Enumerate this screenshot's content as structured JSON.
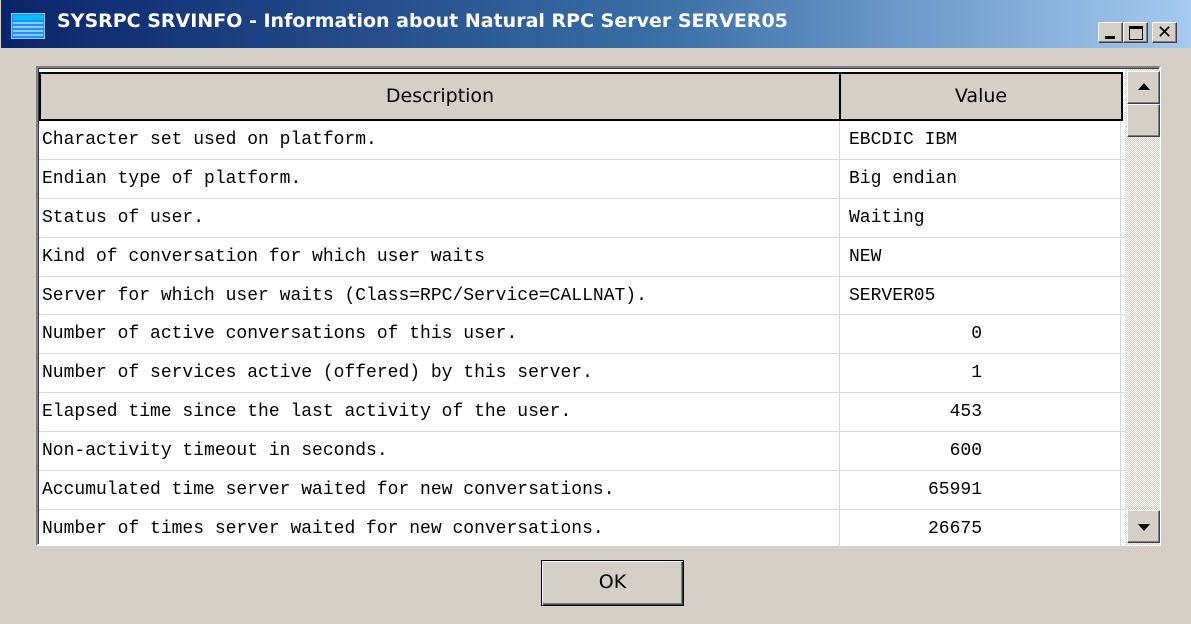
{
  "window": {
    "title": "SYSRPC SRVINFO - Information about Natural RPC Server SERVER05",
    "icon": "app-window-icon",
    "controls": {
      "minimize": "minimize-icon",
      "maximize": "maximize-icon",
      "close": "close-icon"
    }
  },
  "grid": {
    "columns": {
      "description": "Description",
      "value": "Value"
    },
    "rows": [
      {
        "description": "Character set used on platform.",
        "value": "EBCDIC IBM"
      },
      {
        "description": "Endian type of platform.",
        "value": "Big endian"
      },
      {
        "description": "Status of user.",
        "value": "Waiting"
      },
      {
        "description": "Kind of conversation for which user waits",
        "value": "NEW"
      },
      {
        "description": "Server for which user waits (Class=RPC/Service=CALLNAT).",
        "value": "SERVER05"
      },
      {
        "description": "Number of active conversations of this user.",
        "value": "0"
      },
      {
        "description": "Number of services active (offered) by this server.",
        "value": "1"
      },
      {
        "description": "Elapsed time since the last activity of the user.",
        "value": "453"
      },
      {
        "description": "Non-activity timeout in seconds.",
        "value": "600"
      },
      {
        "description": "Accumulated time server waited for new conversations.",
        "value": "65991"
      },
      {
        "description": "Number of times server waited for new conversations.",
        "value": "26675"
      }
    ]
  },
  "buttons": {
    "ok": "OK"
  },
  "colors": {
    "titlebar_start": "#0a246a",
    "titlebar_end": "#a6caf0",
    "window_bg": "#d4d0c8"
  }
}
